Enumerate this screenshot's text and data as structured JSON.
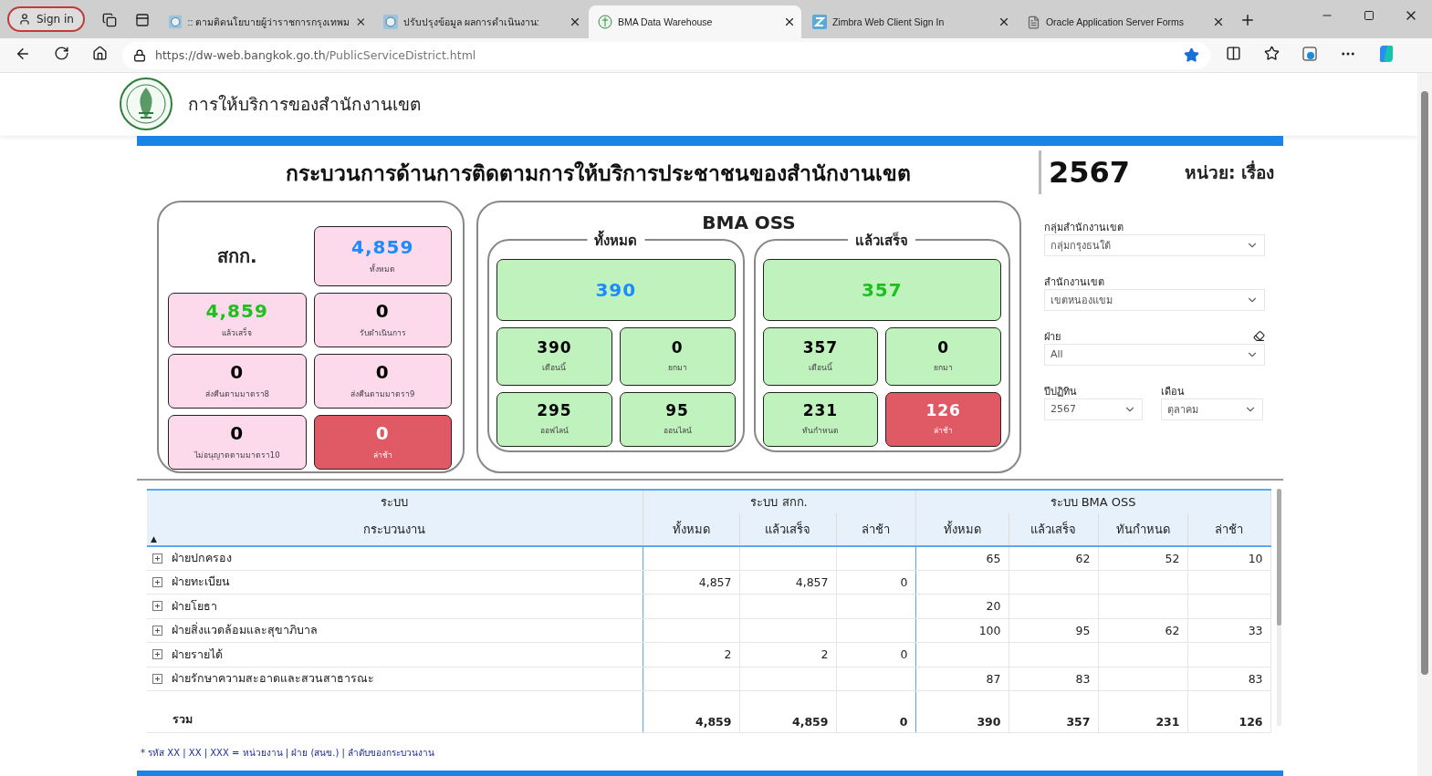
{
  "browser": {
    "sign_in": "Sign in",
    "tabs": [
      {
        "title": ":: ตามติดนโยบายผู้ว่าราชการกรุงเทพม",
        "kind": "seal",
        "selected": false
      },
      {
        "title": "ปรับปรุงข้อมูล ผลการดำเนินงาน:",
        "kind": "seal",
        "selected": false
      },
      {
        "title": "BMA Data Warehouse",
        "kind": "emblem",
        "selected": true
      },
      {
        "title": "Zimbra Web Client Sign In",
        "kind": "z",
        "selected": false
      },
      {
        "title": "Oracle Application Server Forms",
        "kind": "doc",
        "selected": false
      }
    ],
    "url_host": "https://dw-web.bangkok.go.th",
    "url_path": "/PublicServiceDistrict.html"
  },
  "header": {
    "title": "การให้บริการของสำนักงานเขต"
  },
  "report": {
    "title": "กระบวนการด้านการติดตามการให้บริการประชาชนของสำนักงานเขต",
    "year": "2567",
    "unit": "หน่วย: เรื่อง"
  },
  "sakk": {
    "title": "สกก.",
    "cards": [
      {
        "value": "4,859",
        "label": "ทั้งหมด",
        "color": "#1a8cff",
        "alert": false
      },
      {
        "value": "4,859",
        "label": "แล้วเสร็จ",
        "color": "#1fbf1f",
        "alert": false
      },
      {
        "value": "0",
        "label": "รับดำเนินการ",
        "color": "#000000",
        "alert": false
      },
      {
        "value": "0",
        "label": "ส่งคืนตามมาตรา8",
        "color": "#000000",
        "alert": false
      },
      {
        "value": "0",
        "label": "ส่งคืนตามมาตรา9",
        "color": "#000000",
        "alert": false
      },
      {
        "value": "0",
        "label": "ไม่อนุญาตตามมาตรา10",
        "color": "#000000",
        "alert": false
      },
      {
        "value": "0",
        "label": "ล่าช้า",
        "color": "#ffffff",
        "alert": true
      }
    ]
  },
  "oss": {
    "title": "BMA OSS",
    "groups": [
      {
        "title": "ทั้งหมด",
        "main": {
          "value": "390",
          "color": "#1a8cff"
        },
        "cards": [
          {
            "value": "390",
            "label": "เดือนนี้",
            "alert": false
          },
          {
            "value": "0",
            "label": "ยกมา",
            "alert": false
          },
          {
            "value": "295",
            "label": "ออฟไลน์",
            "alert": false
          },
          {
            "value": "95",
            "label": "ออนไลน์",
            "alert": false
          }
        ]
      },
      {
        "title": "แล้วเสร็จ",
        "main": {
          "value": "357",
          "color": "#1fbf1f"
        },
        "cards": [
          {
            "value": "357",
            "label": "เดือนนี้",
            "alert": false
          },
          {
            "value": "0",
            "label": "ยกมา",
            "alert": false
          },
          {
            "value": "231",
            "label": "ทันกำหนด",
            "alert": false
          },
          {
            "value": "126",
            "label": "ล่าช้า",
            "alert": true
          }
        ]
      }
    ]
  },
  "filters": [
    {
      "label": "กลุ่มสำนักงานเขต",
      "value": "กลุ่มกรุงธนใต้",
      "clearable": false
    },
    {
      "label": "สำนักงานเขต",
      "value": "เขตหนองแขม",
      "clearable": false
    },
    {
      "label": "ฝ่าย",
      "value": "All",
      "clearable": true
    }
  ],
  "small_filters": [
    {
      "label": "ปีปฏิทิน",
      "value": "2567"
    },
    {
      "label": "เดือน",
      "value": "ตุลาคม"
    }
  ],
  "table": {
    "group_headers": [
      "ระบบ",
      "ระบบ สกก.",
      "ระบบ BMA OSS"
    ],
    "columns": [
      "กระบวนงาน",
      "ทั้งหมด",
      "แล้วเสร็จ",
      "ล่าช้า",
      "ทั้งหมด",
      "แล้วเสร็จ",
      "ทันกำหนด",
      "ล่าช้า"
    ],
    "sort_mark": "▲",
    "rows": [
      {
        "expanded": false,
        "cells": [
          "ฝ่ายปกครอง",
          "",
          "",
          "",
          "65",
          "62",
          "52",
          "10"
        ]
      },
      {
        "expanded": false,
        "cells": [
          "ฝ่ายทะเบียน",
          "4,857",
          "4,857",
          "0",
          "",
          "",
          "",
          ""
        ]
      },
      {
        "expanded": false,
        "cells": [
          "ฝ่ายโยธา",
          "",
          "",
          "",
          "20",
          "",
          "",
          ""
        ]
      },
      {
        "expanded": false,
        "cells": [
          "ฝ่ายสิ่งแวดล้อมและสุขาภิบาล",
          "",
          "",
          "",
          "100",
          "95",
          "62",
          "33"
        ]
      },
      {
        "expanded": false,
        "cells": [
          "ฝ่ายรายได้",
          "2",
          "2",
          "0",
          "",
          "",
          "",
          ""
        ]
      },
      {
        "expanded": false,
        "cells": [
          "ฝ่ายรักษาความสะอาดและสวนสาธารณะ",
          "",
          "",
          "",
          "87",
          "83",
          "",
          "83"
        ]
      }
    ],
    "total": [
      "รวม",
      "4,859",
      "4,859",
      "0",
      "390",
      "357",
      "231",
      "126"
    ]
  },
  "footnote": "* รหัส XX | XX | XXX = หน่วยงาน | ฝ่าย (สนข.) | ลำดับของกระบวนงาน"
}
